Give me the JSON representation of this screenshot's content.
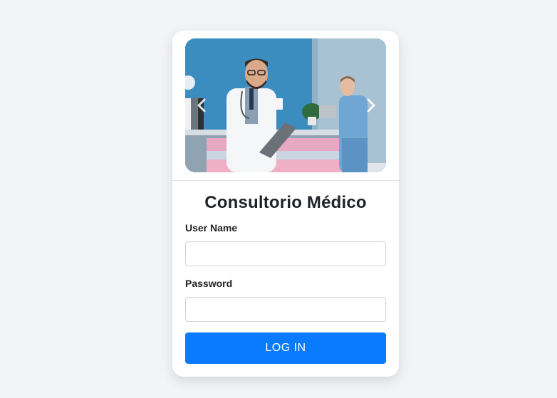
{
  "app": {
    "title": "Consultorio Médico"
  },
  "carousel": {
    "image_subject": "doctor-and-nurse-at-reception",
    "prev_icon": "chevron-left-icon",
    "next_icon": "chevron-right-icon"
  },
  "form": {
    "username_label": "User Name",
    "username_value": "",
    "username_placeholder": "",
    "password_label": "Password",
    "password_value": "",
    "password_placeholder": "",
    "submit_label": "LOG IN"
  },
  "colors": {
    "page_bg": "#f3f4f7",
    "card_bg": "#ffffff",
    "primary": "#0a7bff",
    "text": "#1f2226"
  }
}
